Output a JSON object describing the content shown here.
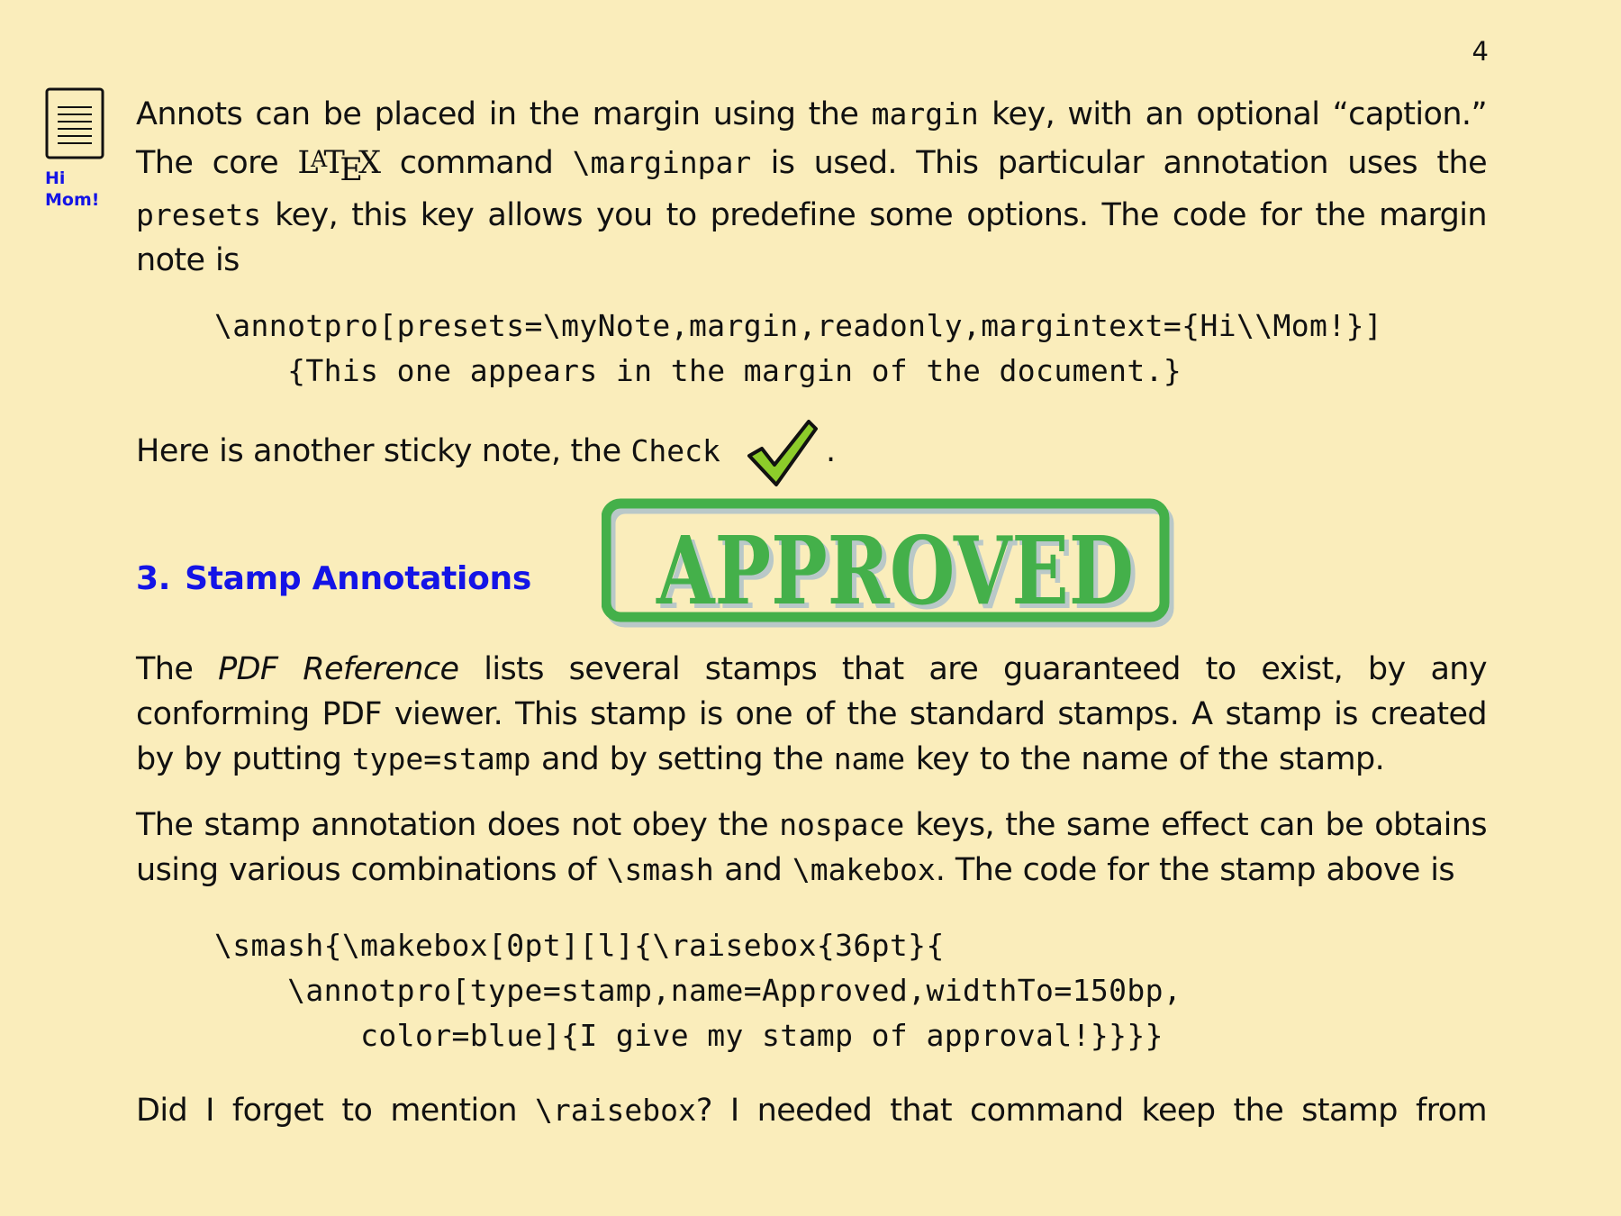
{
  "page": {
    "number": "4"
  },
  "margin_note": {
    "icon": "note-icon",
    "line1": "Hi",
    "line2": "Mom!"
  },
  "intro": {
    "p1_a": "Annots can be placed in the margin using the ",
    "p1_key_margin": "margin",
    "p1_b": " key, with an optional “caption.” The core ",
    "latex_L": "L",
    "latex_A": "A",
    "latex_T": "T",
    "latex_E": "E",
    "latex_X": "X",
    "p1_c": " command ",
    "p1_cmd_marginpar": "\\marginpar",
    "p1_d": " is used.  This particular annotation uses the ",
    "p1_key_presets": "presets",
    "p1_e": " key, this key allows you to predefine some options.  The code for the margin note is"
  },
  "code1": {
    "line1": "\\annotpro[presets=\\myNote,margin,readonly,margintext={Hi\\\\Mom!}]",
    "line2": "    {This one appears in the margin of the document.}"
  },
  "check_line": {
    "text": "Here is another sticky note, the ",
    "name": "Check",
    "period": ".",
    "icon": "check-icon",
    "icon_color": "#8ccc2a"
  },
  "section": {
    "number": "3.",
    "title": "Stamp Annotations",
    "color": "#1414e6"
  },
  "stamp": {
    "label": "APPROVED",
    "color": "#44b04a",
    "shadow": "#b9c8c8"
  },
  "body": {
    "p2_a": "The ",
    "p2_italic": "PDF Reference",
    "p2_b": " lists several stamps that are guaranteed to exist, by any conforming PDF viewer.  This stamp is one of the standard stamps.  A stamp is created by by putting ",
    "p2_key_type": "type=stamp",
    "p2_c": " and by setting the ",
    "p2_key_name": "name",
    "p2_d": " key to the name of the stamp.",
    "p3_a": "The stamp annotation does not obey the ",
    "p3_key_nospace": "nospace",
    "p3_b": " keys, the same effect can be obtains using various combinations of ",
    "p3_cmd_smash": "\\smash",
    "p3_c": " and ",
    "p3_cmd_makebox": "\\makebox",
    "p3_d": ".  The code for the stamp above is",
    "p4_a": "Did I forget to mention ",
    "p4_cmd_raisebox": "\\raisebox",
    "p4_b": "?  I needed that command keep the stamp from"
  },
  "code2": {
    "line1": "\\smash{\\makebox[0pt][l]{\\raisebox{36pt}{",
    "line2": "    \\annotpro[type=stamp,name=Approved,widthTo=150bp,",
    "line3": "        color=blue]{I give my stamp of approval!}}}}"
  }
}
